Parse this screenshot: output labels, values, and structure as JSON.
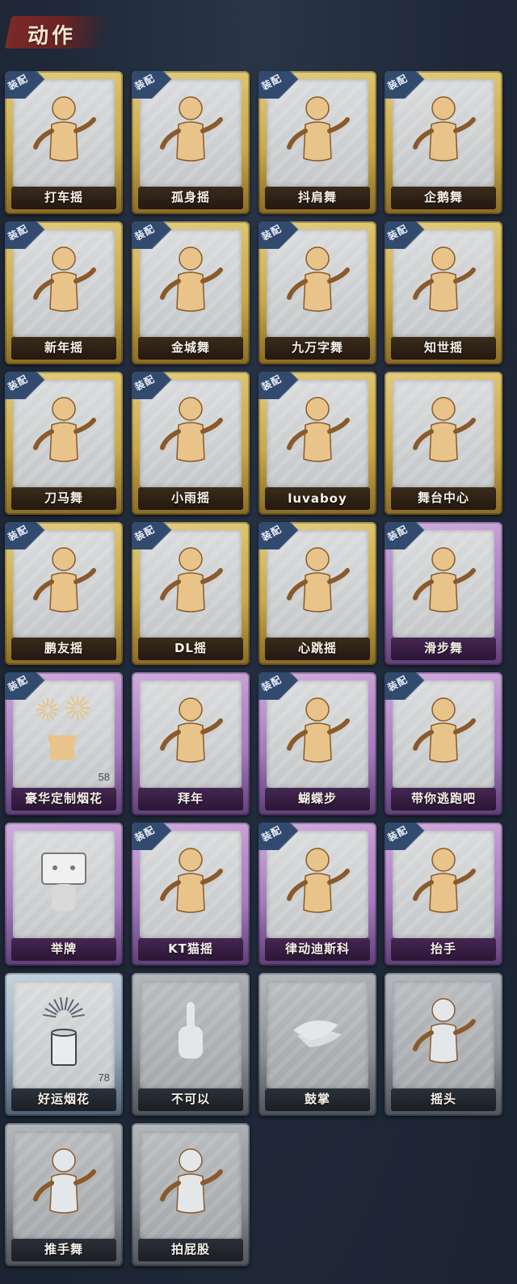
{
  "header": {
    "title": "动作"
  },
  "badge_label": "装配",
  "colors": {
    "gold": "#c9a94a",
    "purple": "#a57cbe",
    "blue": "#94abbd",
    "gray": "#8c9197",
    "badge": "#314a6e",
    "header_brush": "#7b2a28"
  },
  "items": [
    {
      "name": "打车摇",
      "tier": "gold",
      "equipped": true,
      "icon": "figure-dance-icon"
    },
    {
      "name": "孤身摇",
      "tier": "gold",
      "equipped": true,
      "icon": "figure-dance-icon"
    },
    {
      "name": "抖肩舞",
      "tier": "gold",
      "equipped": true,
      "icon": "figure-dance-icon"
    },
    {
      "name": "企鹅舞",
      "tier": "gold",
      "equipped": true,
      "icon": "figure-dance-icon"
    },
    {
      "name": "新年摇",
      "tier": "gold",
      "equipped": true,
      "icon": "figure-dance-icon"
    },
    {
      "name": "金城舞",
      "tier": "gold",
      "equipped": true,
      "icon": "figure-dance-icon"
    },
    {
      "name": "九万字舞",
      "tier": "gold",
      "equipped": true,
      "icon": "figure-dance-icon"
    },
    {
      "name": "知世摇",
      "tier": "gold",
      "equipped": true,
      "icon": "figure-dance-icon"
    },
    {
      "name": "刀马舞",
      "tier": "gold",
      "equipped": true,
      "icon": "figure-dance-icon"
    },
    {
      "name": "小雨摇",
      "tier": "gold",
      "equipped": true,
      "icon": "figure-dance-icon"
    },
    {
      "name": "luvaboy",
      "tier": "gold",
      "equipped": true,
      "icon": "figure-dance-icon"
    },
    {
      "name": "舞台中心",
      "tier": "gold",
      "equipped": false,
      "icon": "figure-dance-icon"
    },
    {
      "name": "鹏友摇",
      "tier": "gold",
      "equipped": true,
      "icon": "figure-dance-icon"
    },
    {
      "name": "DL摇",
      "tier": "gold",
      "equipped": true,
      "icon": "figure-dance-icon"
    },
    {
      "name": "心跳摇",
      "tier": "gold",
      "equipped": true,
      "icon": "figure-dance-icon"
    },
    {
      "name": "滑步舞",
      "tier": "purple",
      "equipped": true,
      "icon": "figure-dance-icon"
    },
    {
      "name": "豪华定制烟花",
      "tier": "purple",
      "equipped": true,
      "icon": "fireworks-icon",
      "count": "58"
    },
    {
      "name": "拜年",
      "tier": "purple",
      "equipped": false,
      "icon": "figure-bow-icon"
    },
    {
      "name": "蝴蝶步",
      "tier": "purple",
      "equipped": true,
      "icon": "figure-dance-icon"
    },
    {
      "name": "带你逃跑吧",
      "tier": "purple",
      "equipped": true,
      "icon": "figure-dance-icon"
    },
    {
      "name": "举牌",
      "tier": "purple",
      "equipped": false,
      "icon": "sign-holder-icon"
    },
    {
      "name": "KT猫摇",
      "tier": "purple",
      "equipped": true,
      "icon": "figure-dance-icon"
    },
    {
      "name": "律动迪斯科",
      "tier": "purple",
      "equipped": true,
      "icon": "figure-dance-icon"
    },
    {
      "name": "抬手",
      "tier": "purple",
      "equipped": true,
      "icon": "figure-raise-hand-icon"
    },
    {
      "name": "好运烟花",
      "tier": "blue",
      "equipped": false,
      "icon": "firework-can-icon",
      "count": "78"
    },
    {
      "name": "不可以",
      "tier": "gray",
      "equipped": false,
      "icon": "finger-wag-icon"
    },
    {
      "name": "鼓掌",
      "tier": "gray",
      "equipped": false,
      "icon": "clap-icon"
    },
    {
      "name": "摇头",
      "tier": "gray",
      "equipped": false,
      "icon": "figure-shake-head-icon"
    },
    {
      "name": "推手舞",
      "tier": "gray",
      "equipped": false,
      "icon": "figure-push-icon"
    },
    {
      "name": "拍屁股",
      "tier": "gray",
      "equipped": false,
      "icon": "figure-spank-icon"
    }
  ]
}
